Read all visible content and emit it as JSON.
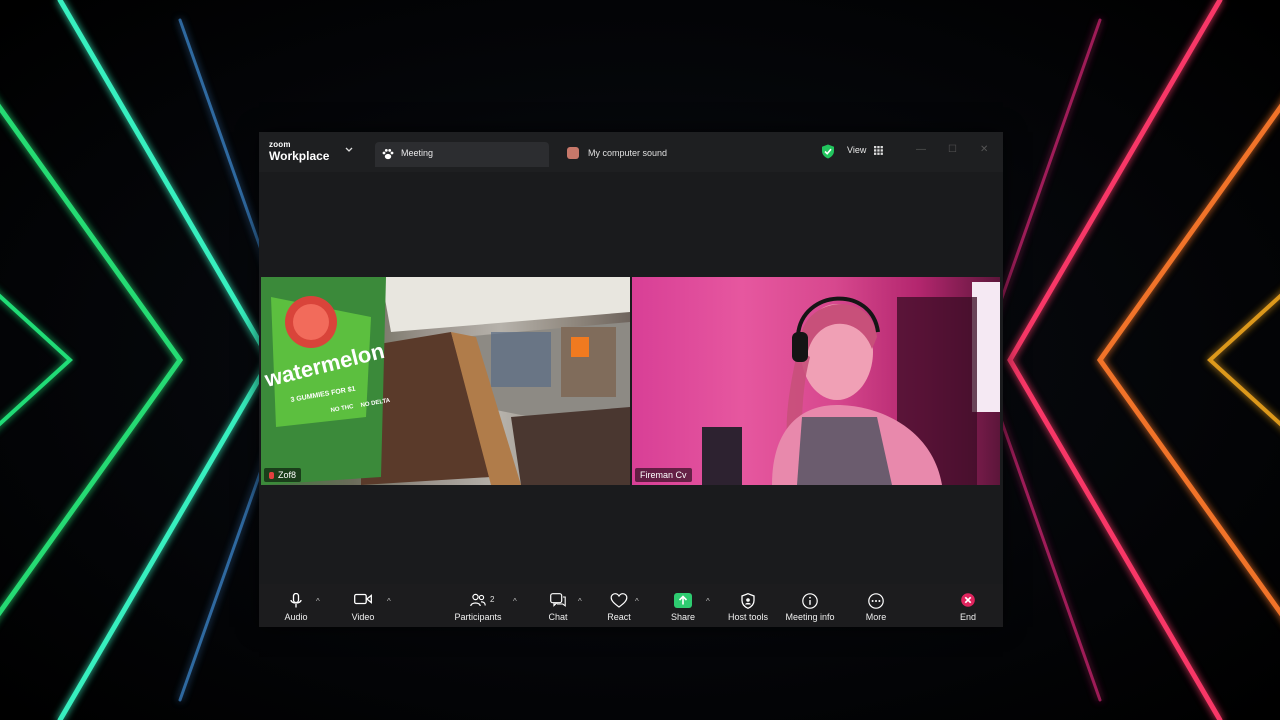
{
  "app": {
    "logo_small": "zoom",
    "logo_big": "Workplace"
  },
  "tabs": [
    {
      "label": "Meeting",
      "icon": "paw-icon"
    },
    {
      "label": "My computer sound",
      "icon": "computer-sound-icon"
    }
  ],
  "header": {
    "view_label": "View"
  },
  "participants": [
    {
      "name": "Zof8",
      "muted": true
    },
    {
      "name": "Fireman Cv",
      "muted": false
    }
  ],
  "tile_text": {
    "brand": "watermelon",
    "sub": "3 GUMMIES FOR $1",
    "tag1": "NO THC",
    "tag2": "NO DELTA"
  },
  "toolbar": {
    "audio": "Audio",
    "video": "Video",
    "participants": "Participants",
    "participants_count": "2",
    "chat": "Chat",
    "react": "React",
    "share": "Share",
    "host_tools": "Host tools",
    "meeting_info": "Meeting info",
    "more": "More",
    "end": "End"
  },
  "colors": {
    "share_green": "#2ecc71",
    "end_red": "#e0245e",
    "shield_green": "#22c55e"
  }
}
